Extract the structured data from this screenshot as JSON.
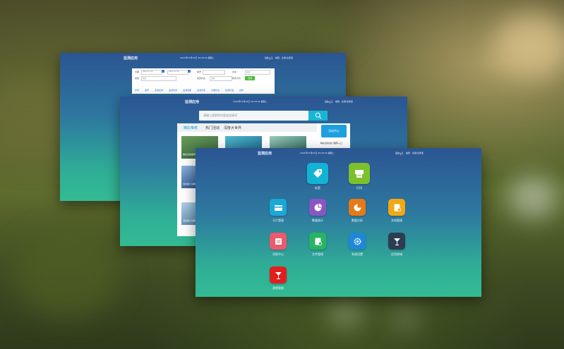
{
  "window_back": {
    "title": "监测应用",
    "datetime": "2021年07月22日 09:18:30 星期二",
    "user": "Why1",
    "user_links": "编辑 · 注销/注册退",
    "form": {
      "label_date": "日期",
      "date_from": "2021-07-22",
      "date_to": "2021-07-22",
      "label_code": "编号",
      "label_status": "状态",
      "status_value": "全部",
      "label_type": "类型",
      "type_value": "全部",
      "label_check": "检查状态",
      "check_value": "全部",
      "label_sort": "排序方式",
      "submit_label": "查询"
    },
    "columns": [
      "序号",
      "编号",
      "监测名称",
      "监测时间",
      "监测结果",
      "监测状态",
      "处理状态",
      "检测标准",
      "操作"
    ]
  },
  "window_middle": {
    "title": "监测应用",
    "datetime": "2021年07月22日 09:18:30 星期二",
    "user": "Why1",
    "user_links": "编辑 · 注销/注册退",
    "search_placeholder": "请输入搜索的内容或关键词",
    "tabs": [
      "精彩推荐",
      "热门活动",
      "深度大世界"
    ],
    "side_badge": "活动中心",
    "side_item": "精彩活动/热门推荐入口",
    "cards": [
      "精彩活动推荐",
      "活动简介说明",
      "活动简介说明",
      "活动简介说明"
    ]
  },
  "window_front": {
    "title": "监测应用",
    "datetime": "2021年07月22日 09:18:30 星期二",
    "user": "Why1",
    "user_links": "编辑 · 注销/注册退",
    "apps": [
      {
        "label": "标签",
        "color": "#13b3d3",
        "icon": "tag-icon"
      },
      {
        "label": "打印",
        "color": "#7cc12b",
        "icon": "printer-icon"
      },
      {
        "label": "卡片管理",
        "color": "#1aa9d6",
        "icon": "card-icon"
      },
      {
        "label": "数据统计",
        "color": "#8a56c4",
        "icon": "pie-chart-icon"
      },
      {
        "label": "数据分析",
        "color": "#e67a16",
        "icon": "pie-chart-icon"
      },
      {
        "label": "文档管理",
        "color": "#f0a915",
        "icon": "document-icon"
      },
      {
        "label": "消息中心",
        "color": "#ec5a6e",
        "icon": "message-icon"
      },
      {
        "label": "文件管理",
        "color": "#27b561",
        "icon": "document-add-icon"
      },
      {
        "label": "系统设置",
        "color": "#1e88d8",
        "icon": "gear-icon"
      },
      {
        "label": "应用商城",
        "color": "#2c3d52",
        "icon": "cocktail-icon"
      },
      {
        "label": "酒吧管理",
        "color": "#e11e1e",
        "icon": "cocktail-icon"
      }
    ]
  }
}
